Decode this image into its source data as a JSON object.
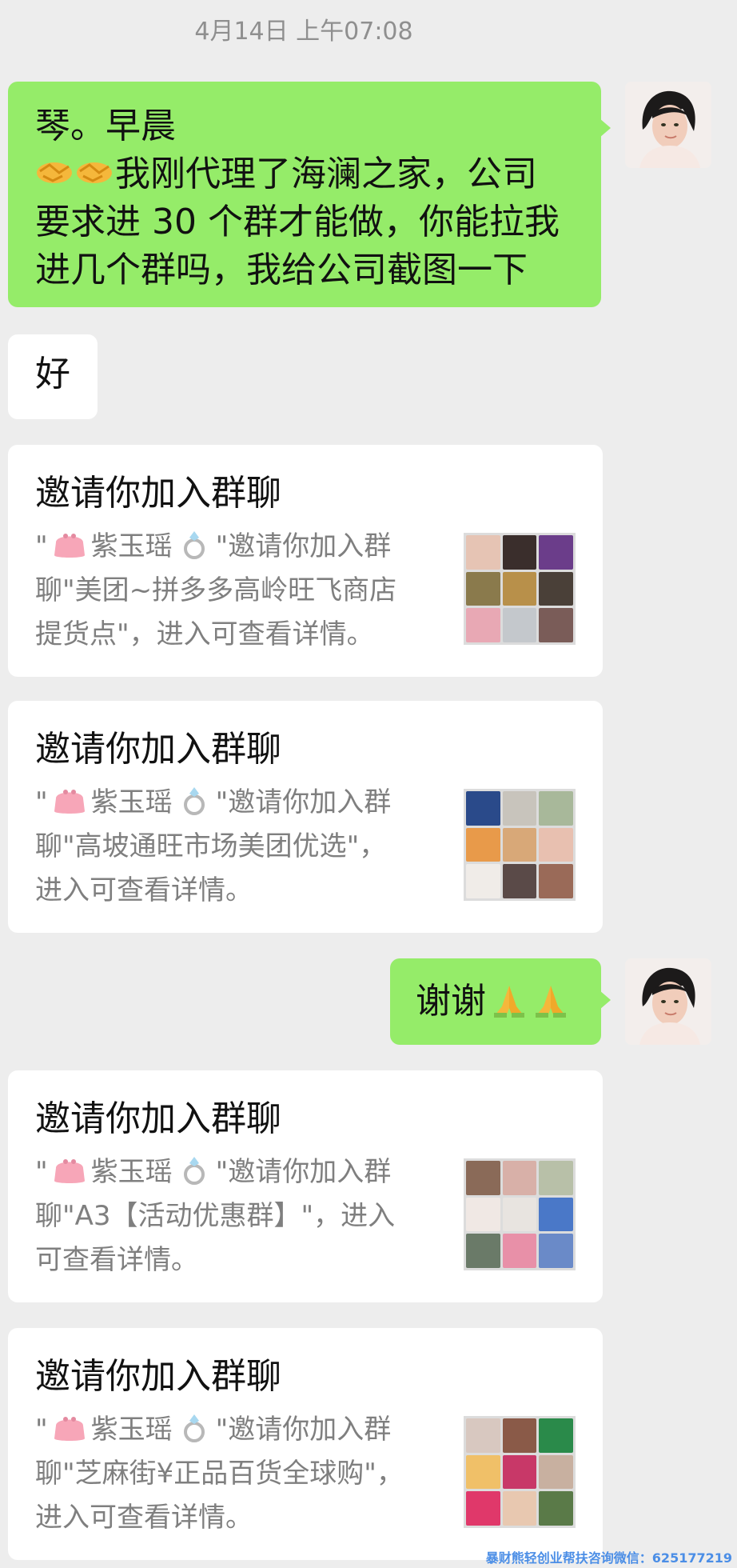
{
  "timestamp": "4月14日 上午07:08",
  "messages": {
    "m1": {
      "sender": "me",
      "line1": "琴。早晨",
      "line2": "我刚代理了海澜之家，公司",
      "line3": "要求进 30 个群才能做，你能拉我",
      "line4": "进几个群吗，我给公司截图一下",
      "emoji": "handshake-emoji"
    },
    "m2": {
      "sender": "other",
      "text": "好"
    },
    "m3": {
      "sender": "other",
      "title": "邀请你加入群聊",
      "quote_open": "\"",
      "inviter": "紫玉瑶",
      "line1_tail": "\"邀请你加入群",
      "line2": "聊\"美团~拼多多高岭旺飞商店",
      "line3": "提货点\"，进入可查看详情。"
    },
    "m4": {
      "sender": "other",
      "title": "邀请你加入群聊",
      "quote_open": "\"",
      "inviter": "紫玉瑶",
      "line1_tail": "\"邀请你加入群",
      "line2": "聊\"高坡通旺市场美团优选\"，",
      "line3": "进入可查看详情。"
    },
    "m5": {
      "sender": "me",
      "text": "谢谢",
      "emoji": "praying-hands-emoji"
    },
    "m6": {
      "sender": "other",
      "title": "邀请你加入群聊",
      "quote_open": "\"",
      "inviter": "紫玉瑶",
      "line1_tail": "\"邀请你加入群",
      "line2": "聊\"A3【活动优惠群】\"，进入",
      "line3": "可查看详情。"
    },
    "m7": {
      "sender": "other",
      "title": "邀请你加入群聊",
      "quote_open": "\"",
      "inviter": "紫玉瑶",
      "line1_tail": "\"邀请你加入群",
      "line2": "聊\"芝麻街¥正品百货全球购\"，",
      "line3": "进入可查看详情。"
    }
  },
  "watermark": "暴财熊轻创业帮扶咨询微信：625177219",
  "colors": {
    "background": "#ededed",
    "my_bubble": "#95ec69",
    "other_bubble": "#ffffff",
    "muted_text": "#7f7f7f"
  }
}
